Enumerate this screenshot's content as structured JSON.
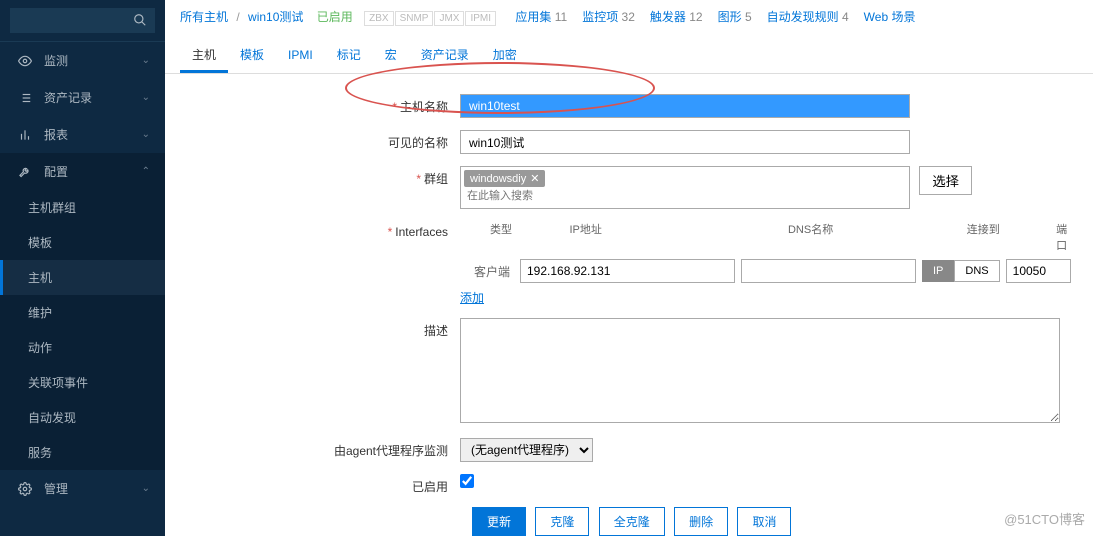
{
  "sidebar": {
    "search_placeholder": "",
    "menu": [
      {
        "icon": "eye",
        "label": "监测"
      },
      {
        "icon": "list",
        "label": "资产记录"
      },
      {
        "icon": "chart",
        "label": "报表"
      },
      {
        "icon": "wrench",
        "label": "配置",
        "expanded": true,
        "submenu": [
          {
            "label": "主机群组"
          },
          {
            "label": "模板"
          },
          {
            "label": "主机",
            "active": true
          },
          {
            "label": "维护"
          },
          {
            "label": "动作"
          },
          {
            "label": "关联项事件"
          },
          {
            "label": "自动发现"
          },
          {
            "label": "服务"
          }
        ]
      },
      {
        "icon": "gear",
        "label": "管理"
      }
    ]
  },
  "breadcrumb": {
    "parent": "所有主机",
    "current": "win10测试",
    "status": "已启用",
    "indicators": [
      "ZBX",
      "SNMP",
      "JMX",
      "IPMI"
    ],
    "meta": [
      {
        "label": "应用集",
        "count": "11"
      },
      {
        "label": "监控项",
        "count": "32"
      },
      {
        "label": "触发器",
        "count": "12"
      },
      {
        "label": "图形",
        "count": "5"
      },
      {
        "label": "自动发现规则",
        "count": "4"
      },
      {
        "label": "Web 场景",
        "count": ""
      }
    ]
  },
  "tabs": [
    "主机",
    "模板",
    "IPMI",
    "标记",
    "宏",
    "资产记录",
    "加密"
  ],
  "form": {
    "hostname_label": "主机名称",
    "hostname_value": "win10test",
    "visible_label": "可见的名称",
    "visible_value": "win10测试",
    "groups_label": "群组",
    "group_tag": "windowsdiy",
    "group_placeholder": "在此输入搜索",
    "select_btn": "选择",
    "interfaces_label": "Interfaces",
    "interface_headers": {
      "type": "类型",
      "ip": "IP地址",
      "dns": "DNS名称",
      "connect": "连接到",
      "port": "端口"
    },
    "client_label": "客户端",
    "ip_value": "192.168.92.131",
    "dns_value": "",
    "ip_btn": "IP",
    "dns_btn": "DNS",
    "port_value": "10050",
    "add_link": "添加",
    "desc_label": "描述",
    "desc_value": "",
    "agent_label": "由agent代理程序监测",
    "agent_value": "(无agent代理程序)",
    "enabled_label": "已启用"
  },
  "buttons": {
    "update": "更新",
    "clone": "克隆",
    "fullclone": "全克隆",
    "delete": "删除",
    "cancel": "取消"
  },
  "watermark": "@51CTO博客"
}
